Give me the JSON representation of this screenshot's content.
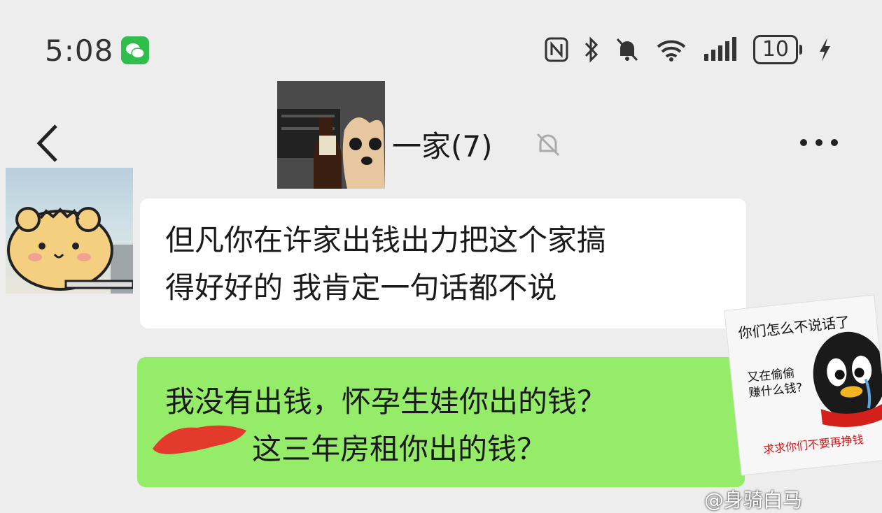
{
  "status_bar": {
    "time": "5:08",
    "battery": "10",
    "icons": [
      "wechat-icon",
      "nfc-icon",
      "bluetooth-icon",
      "bell-off-icon",
      "wifi-icon",
      "signal-icon",
      "battery-icon",
      "charging-icon"
    ]
  },
  "header": {
    "title": "一家(7)",
    "icons": [
      "back-icon",
      "mute-icon",
      "more-icon"
    ]
  },
  "messages": [
    {
      "direction": "incoming",
      "text_line1": "但凡你在许家出钱出力把这个家搞",
      "text_line2": "得好好的 我肯定一句话都不说"
    },
    {
      "direction": "outgoing",
      "text_line1": "我没有出钱，怀孕生娃你出的钱？",
      "text_line2": "这三年房租你出的钱？"
    }
  ],
  "sticker": {
    "top": "你们怎么不说话了",
    "mid_line1": "又在偷偷",
    "mid_line2": "赚什么钱?",
    "bottom": "求求你们不要再挣钱"
  },
  "watermark": "@身骑白马",
  "colors": {
    "background": "#ededed",
    "outgoing_bubble": "#95ec69",
    "incoming_bubble": "#ffffff",
    "wechat_green": "#2fbd4c",
    "redaction": "#e23b2c"
  }
}
